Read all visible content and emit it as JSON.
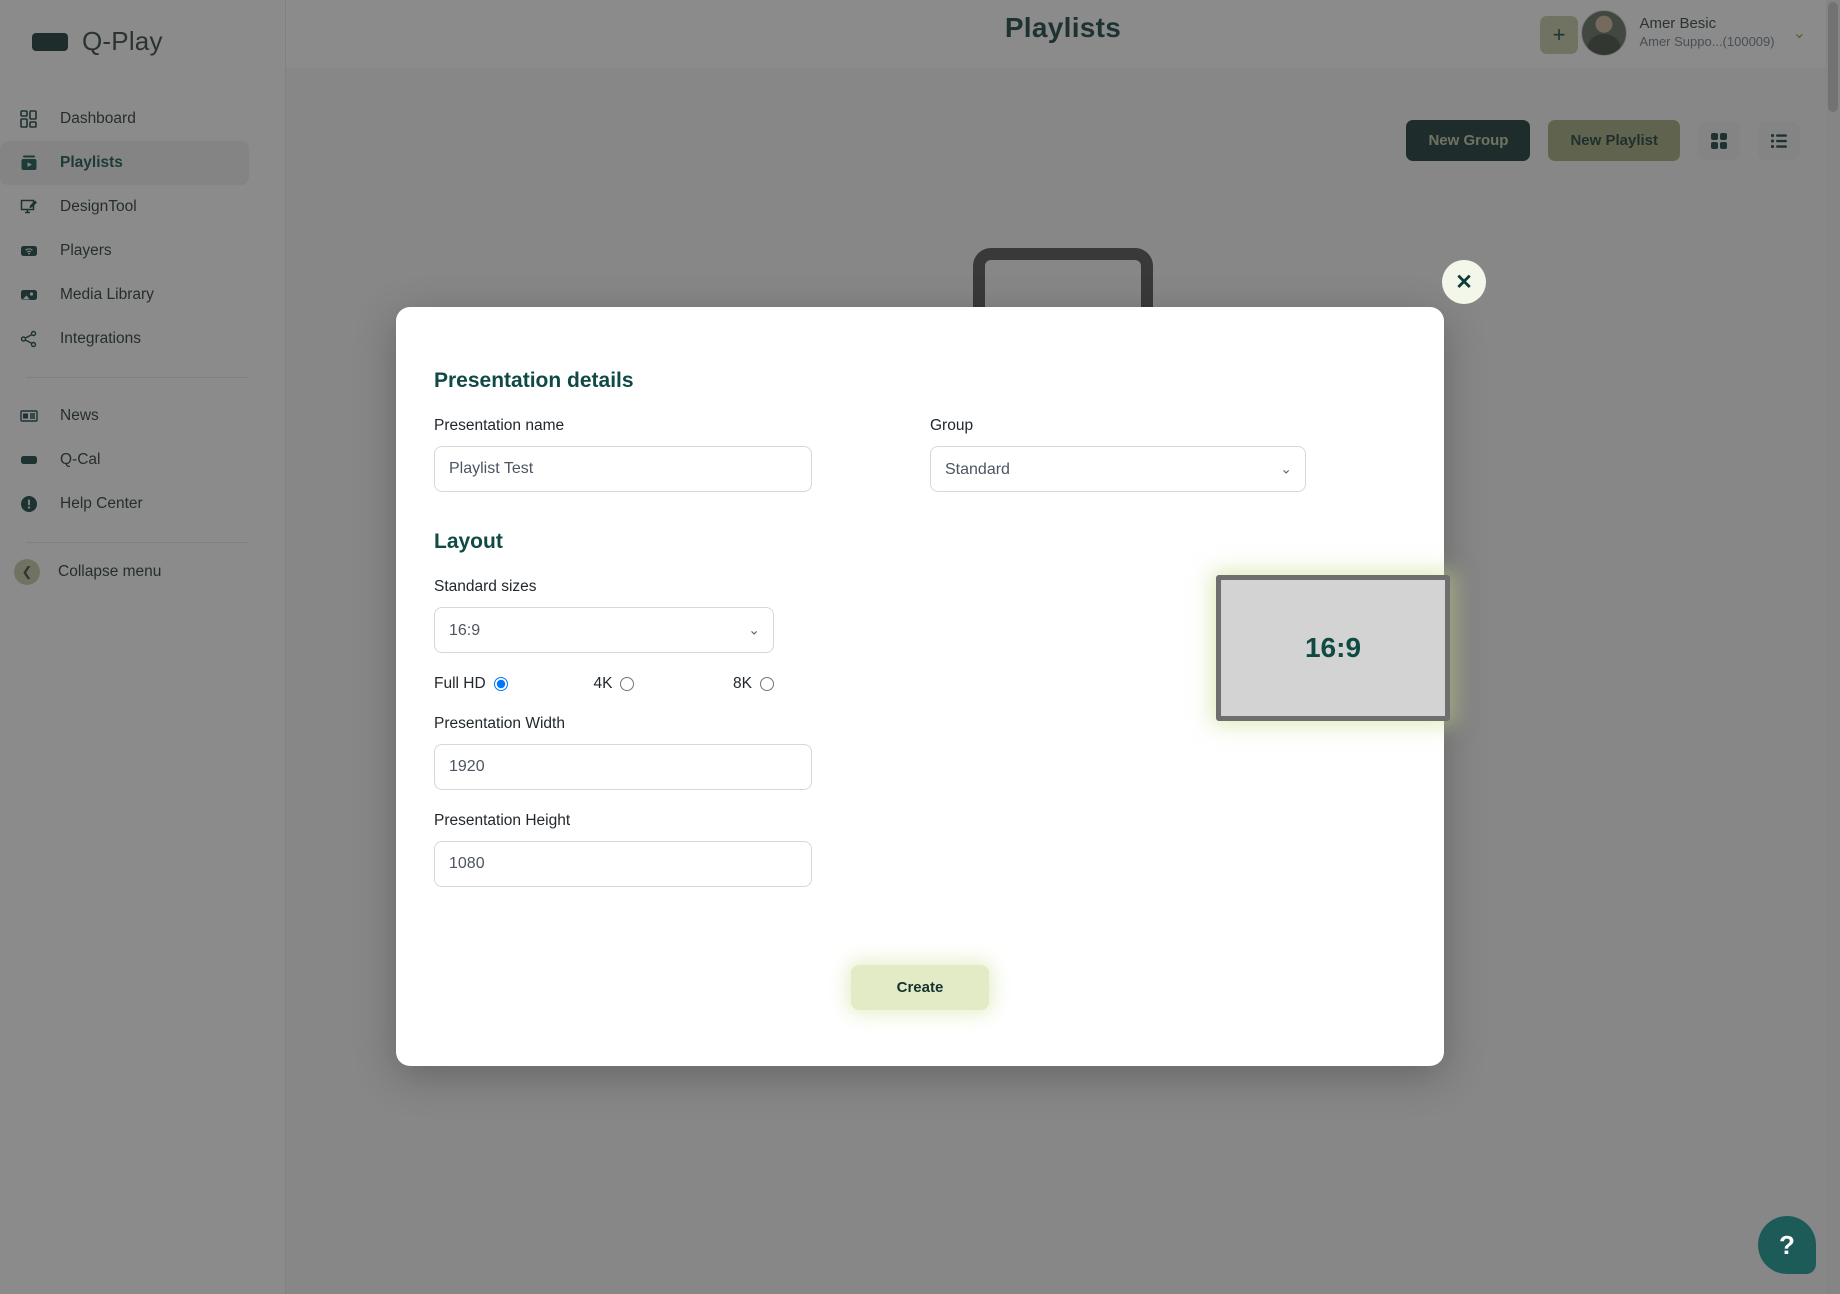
{
  "brand": {
    "name": "Q-Play"
  },
  "header": {
    "title": "Playlists",
    "add_button_label": "+",
    "user": {
      "name": "Amer Besic",
      "subtitle": "Amer Suppo...(100009)",
      "caret": "⌄"
    }
  },
  "sidebar": {
    "items": [
      {
        "label": "Dashboard",
        "icon": "dashboard-icon"
      },
      {
        "label": "Playlists",
        "icon": "playlists-icon"
      },
      {
        "label": "DesignTool",
        "icon": "design-tool-icon"
      },
      {
        "label": "Players",
        "icon": "players-icon"
      },
      {
        "label": "Media Library",
        "icon": "media-library-icon"
      },
      {
        "label": "Integrations",
        "icon": "integrations-icon"
      }
    ],
    "secondary_items": [
      {
        "label": "News",
        "icon": "news-icon"
      },
      {
        "label": "Q-Cal",
        "icon": "calendar-icon"
      },
      {
        "label": "Help Center",
        "icon": "info-icon"
      }
    ],
    "collapse_label": "Collapse menu",
    "collapse_icon": "chevron-left-icon"
  },
  "content": {
    "new_group_label": "New Group",
    "new_playlist_label": "New Playlist",
    "grid_view_icon": "grid-view-icon",
    "list_view_icon": "list-view-icon"
  },
  "modal": {
    "close_label": "✕",
    "details_title": "Presentation details",
    "name_label": "Presentation name",
    "name_value": "Playlist Test",
    "group_label": "Group",
    "group_value": "Standard",
    "group_options": [
      "Standard"
    ],
    "layout_title": "Layout",
    "standard_sizes_label": "Standard sizes",
    "standard_sizes_value": "16:9",
    "standard_sizes_options": [
      "16:9"
    ],
    "resolutions": [
      {
        "label": "Full HD",
        "selected": true
      },
      {
        "label": "4K",
        "selected": false
      },
      {
        "label": "8K",
        "selected": false
      }
    ],
    "width_label": "Presentation Width",
    "width_value": "1920",
    "height_label": "Presentation Height",
    "height_value": "1080",
    "preview_ratio": "16:9",
    "create_label": "Create"
  },
  "help": {
    "label": "?"
  },
  "colors": {
    "brand_dark": "#0f2e2c",
    "accent_olive": "#a0a878",
    "accent_light": "#e2ebc5",
    "teal_text": "#0f4a45"
  }
}
